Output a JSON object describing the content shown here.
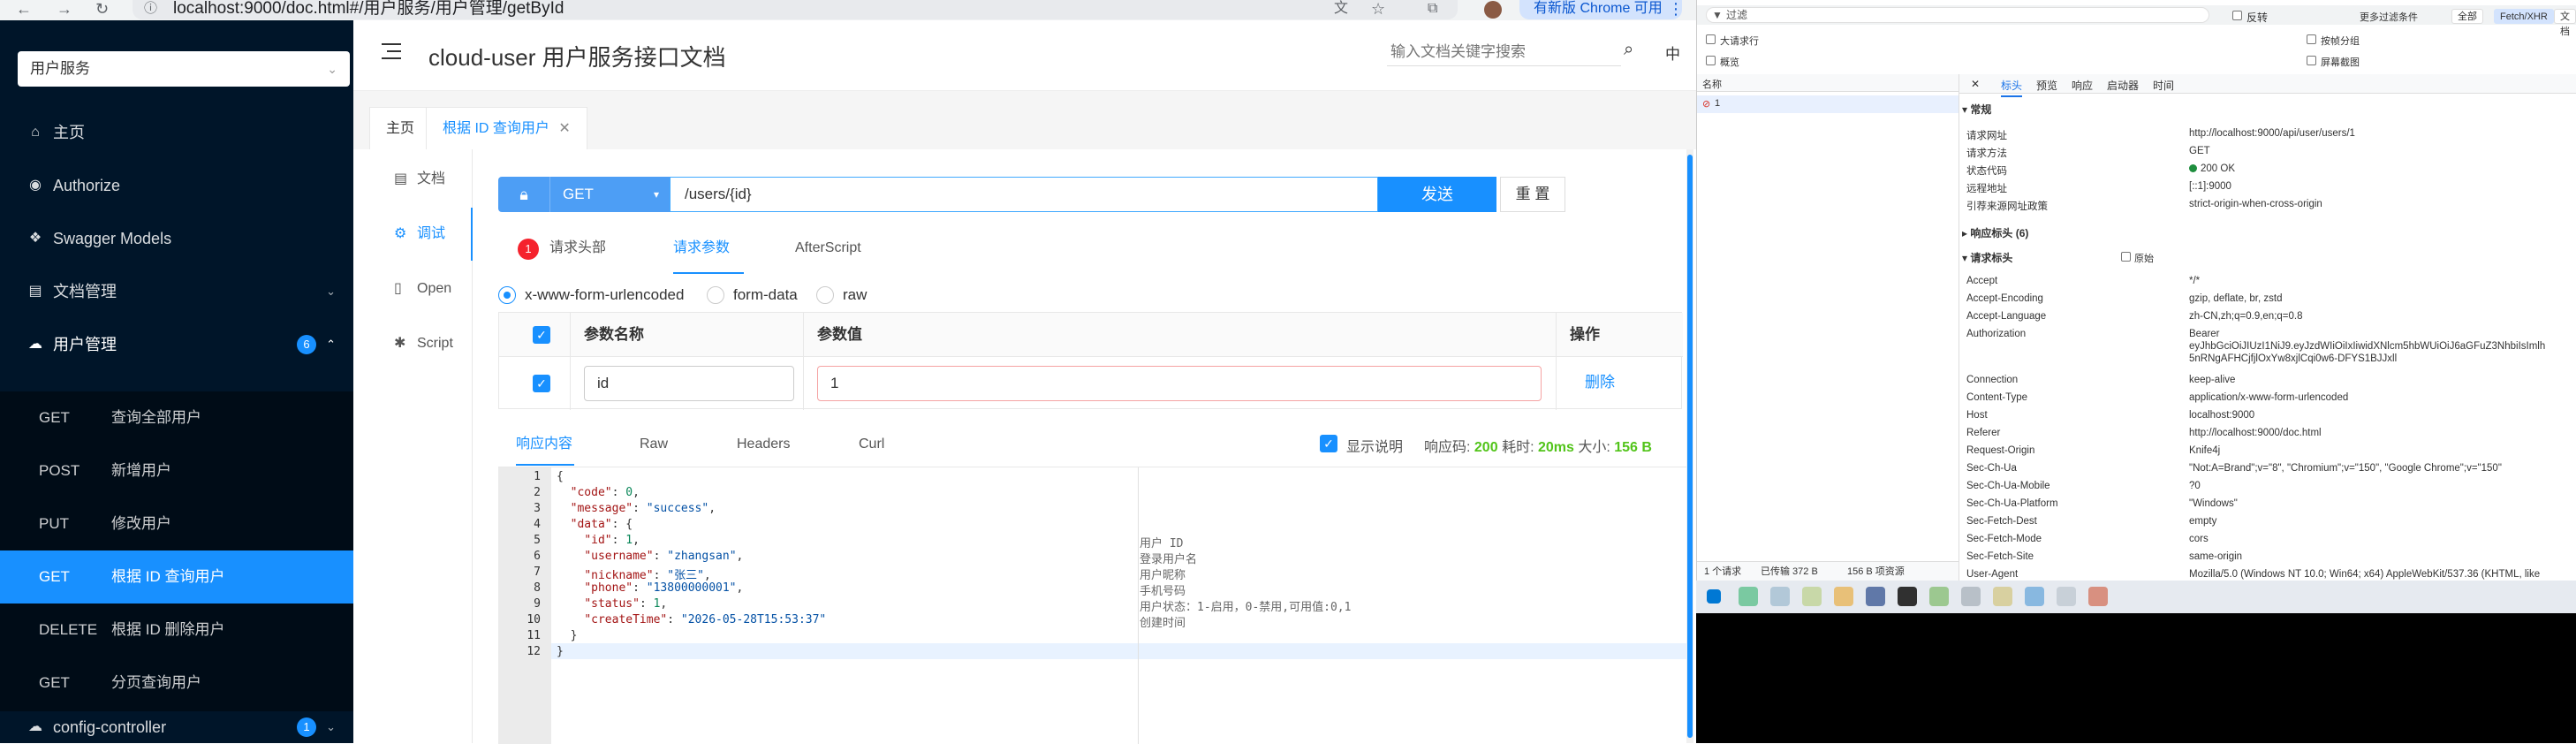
{
  "browser": {
    "url": "localhost:9000/doc.html#/用户服务/用户管理/getById",
    "update_label": "有新版 Chrome 可用"
  },
  "sidebar": {
    "service_selected": "用户服务",
    "items": [
      {
        "label": "主页",
        "icon": "home-icon"
      },
      {
        "label": "Authorize",
        "icon": "authorize-icon"
      },
      {
        "label": "Swagger Models",
        "icon": "models-icon"
      },
      {
        "label": "文档管理",
        "icon": "folder-icon"
      },
      {
        "label": "用户管理",
        "icon": "cloud-icon",
        "badge": "6"
      }
    ],
    "sub_items": [
      {
        "method": "GET",
        "label": "查询全部用户"
      },
      {
        "method": "POST",
        "label": "新增用户"
      },
      {
        "method": "PUT",
        "label": "修改用户"
      },
      {
        "method": "GET",
        "label": "根据 ID 查询用户"
      },
      {
        "method": "DELETE",
        "label": "根据 ID 删除用户"
      },
      {
        "method": "GET",
        "label": "分页查询用户"
      }
    ],
    "config_item": {
      "label": "config-controller",
      "badge": "1"
    }
  },
  "header": {
    "title": "cloud-user 用户服务接口文档",
    "search_placeholder": "输入文档关键字搜索",
    "lang": "中"
  },
  "tabs": [
    {
      "label": "主页"
    },
    {
      "label": "根据 ID 查询用户"
    }
  ],
  "vtabs": [
    {
      "label": "文档"
    },
    {
      "label": "调试"
    },
    {
      "label": "Open"
    },
    {
      "label": "Script"
    }
  ],
  "request": {
    "method": "GET",
    "path": "/users/{id}",
    "send_label": "发送",
    "reset_label": "重 置",
    "tab_headers": "请求头部",
    "tab_headers_count": "1",
    "tab_params": "请求参数",
    "tab_afterscript": "AfterScript",
    "content_types": [
      "x-www-form-urlencoded",
      "form-data",
      "raw"
    ],
    "table_headers": {
      "name": "参数名称",
      "value": "参数值",
      "action": "操作"
    },
    "param_name": "id",
    "param_value": "1",
    "delete_label": "删除"
  },
  "response": {
    "tabs": [
      "响应内容",
      "Raw",
      "Headers",
      "Curl"
    ],
    "show_desc": "显示说明",
    "code_label": "响应码:",
    "code": "200",
    "time_label": "耗时:",
    "time": "20ms",
    "size_label": "大小:",
    "size": "156 B",
    "line_numbers": [
      "1",
      "2",
      "3",
      "4",
      "5",
      "6",
      "7",
      "8",
      "9",
      "10",
      "11",
      "12"
    ],
    "descs": {
      "id": "用户 ID",
      "username": "登录用户名",
      "nickname": "用户昵称",
      "phone": "手机号码",
      "status": "用户状态：1-启用，0-禁用,可用值:0,1",
      "createTime": "创建时间"
    }
  },
  "devtools": {
    "filter_placeholder": "过滤",
    "invert": "反转",
    "more_filters": "更多过滤条件",
    "all": "全部",
    "fetch_xhr": "Fetch/XHR",
    "doc": "文档",
    "big_rows": "大请求行",
    "overview": "概览",
    "group_by_frame": "按帧分组",
    "screenshot": "屏幕截图",
    "name_col": "名称",
    "request_name": "1",
    "detail_tabs": [
      "标头",
      "预览",
      "响应",
      "启动器",
      "时间"
    ],
    "general": "▾ 常规",
    "general_rows": [
      {
        "k": "请求网址",
        "v": "http://localhost:9000/api/user/users/1"
      },
      {
        "k": "请求方法",
        "v": "GET"
      },
      {
        "k": "状态代码",
        "v": "200 OK"
      },
      {
        "k": "远程地址",
        "v": "[::1]:9000"
      },
      {
        "k": "引荐来源网址政策",
        "v": "strict-origin-when-cross-origin"
      }
    ],
    "response_headers": "▸ 响应标头 (6)",
    "request_headers": "▾ 请求标头",
    "raw": "原始",
    "req_rows": [
      {
        "k": "Accept",
        "v": "*/*"
      },
      {
        "k": "Accept-Encoding",
        "v": "gzip, deflate, br, zstd"
      },
      {
        "k": "Accept-Language",
        "v": "zh-CN,zh;q=0.9,en;q=0.8"
      },
      {
        "k": "Authorization",
        "v": "Bearer"
      },
      {
        "k": "",
        "v": "eyJhbGciOiJIUzI1NiJ9.eyJzdWIiOiIxIiwidXNlcm5hbWUiOiJ6aGFuZ3NhbiIsImlh"
      },
      {
        "k": "",
        "v": "5nRNgAFHCjfjlOxYw8xjlCqi0w6-DFYS1BJJxll"
      },
      {
        "k": "Connection",
        "v": "keep-alive"
      },
      {
        "k": "Content-Type",
        "v": "application/x-www-form-urlencoded"
      },
      {
        "k": "Host",
        "v": "localhost:9000"
      },
      {
        "k": "Referer",
        "v": "http://localhost:9000/doc.html"
      },
      {
        "k": "Request-Origin",
        "v": "Knife4j"
      },
      {
        "k": "Sec-Ch-Ua",
        "v": "\"Not:A=Brand\";v=\"8\", \"Chromium\";v=\"150\", \"Google Chrome\";v=\"150\""
      },
      {
        "k": "Sec-Ch-Ua-Mobile",
        "v": "?0"
      },
      {
        "k": "Sec-Ch-Ua-Platform",
        "v": "\"Windows\""
      },
      {
        "k": "Sec-Fetch-Dest",
        "v": "empty"
      },
      {
        "k": "Sec-Fetch-Mode",
        "v": "cors"
      },
      {
        "k": "Sec-Fetch-Site",
        "v": "same-origin"
      },
      {
        "k": "User-Agent",
        "v": "Mozilla/5.0 (Windows NT 10.0; Win64; x64) AppleWebKit/537.36 (KHTML, like"
      }
    ],
    "footer_requests": "1 个请求",
    "footer_transferred": "已传输 372 B",
    "footer_resources": "156 B 项资源"
  },
  "colors": {
    "primary": "#1890ff",
    "sidebar_bg": "#001529",
    "submenu_bg": "#000c17",
    "success": "#52c41a"
  }
}
